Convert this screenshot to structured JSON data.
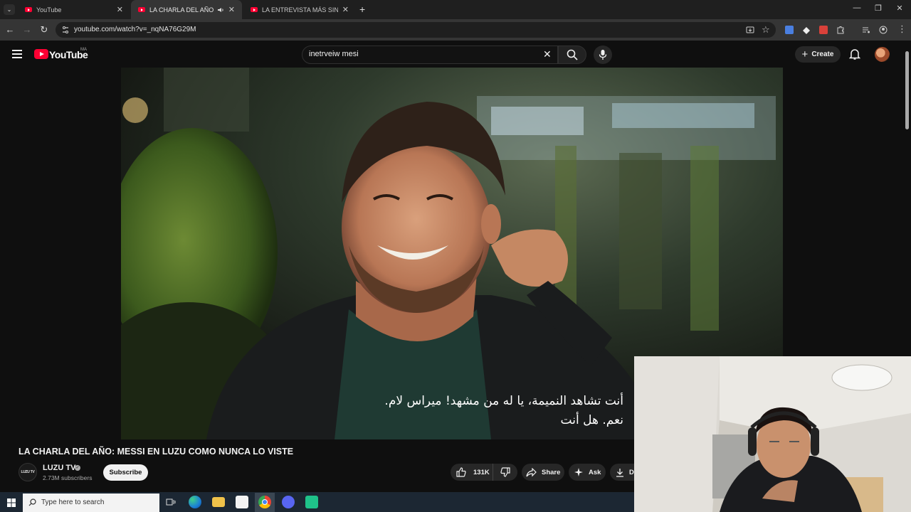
{
  "browser": {
    "tabs": [
      {
        "title": "YouTube",
        "active": false
      },
      {
        "title": "LA CHARLA DEL AÑO: MES",
        "active": true
      },
      {
        "title": "LA ENTREVISTA MÁS SINCERA",
        "active": false
      }
    ],
    "url": "youtube.com/watch?v=_nqNA76G29M"
  },
  "youtube": {
    "wordmark": "YouTube",
    "country_code": "MA",
    "search_value": "inetrveiw mesi",
    "create_label": "Create"
  },
  "video": {
    "captions": [
      "أنت تشاهد النميمة، يا له من مشهد! ميراس لام.",
      "نعم. هل أنت"
    ],
    "title": "LA CHARLA DEL AÑO: MESSI EN LUZU COMO NUNCA LO VISTE"
  },
  "channel": {
    "avatar_text": "LUZU TV",
    "name": "LUZU TV",
    "verified_mark": "✓",
    "subscribers": "2.73M subscribers",
    "subscribe_label": "Subscribe"
  },
  "actions": {
    "likes": "131K",
    "share_label": "Share",
    "ask_label": "Ask",
    "download_label": "Do"
  },
  "taskbar": {
    "search_placeholder": "Type here to search"
  },
  "colors": {
    "youtube_red": "#ff0033",
    "page_bg": "#0f0f0f",
    "pill_bg": "#272727"
  }
}
